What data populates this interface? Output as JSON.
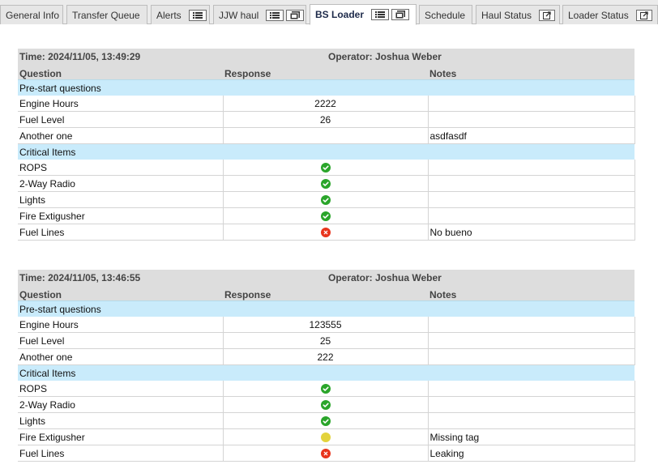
{
  "tabs": [
    {
      "label": "General Info",
      "active": false,
      "buttons": []
    },
    {
      "label": "Transfer Queue",
      "active": false,
      "buttons": []
    },
    {
      "label": "Alerts",
      "active": false,
      "buttons": [
        "list-icon"
      ]
    },
    {
      "label": "JJW haul",
      "active": false,
      "buttons": [
        "list-icon",
        "images-icon"
      ]
    },
    {
      "label": "BS Loader",
      "active": true,
      "buttons": [
        "list-icon",
        "images-icon"
      ]
    },
    {
      "label": "Schedule",
      "active": false,
      "buttons": []
    },
    {
      "label": "Haul Status",
      "active": false,
      "buttons": [
        "external-link-icon"
      ]
    },
    {
      "label": "Loader Status",
      "active": false,
      "buttons": [
        "external-link-icon"
      ]
    }
  ],
  "columns": {
    "question": "Question",
    "response": "Response",
    "notes": "Notes"
  },
  "colors": {
    "ok": "#2aa52a",
    "warn": "#e3d33c",
    "fail": "#e8341c",
    "section": "#c9ebfb",
    "header": "#dddddd"
  },
  "reports": [
    {
      "time": "Time: 2024/11/05, 13:49:29",
      "operator": "Operator: Joshua Weber",
      "sections": [
        {
          "title": "Pre-start questions",
          "rows": [
            {
              "question": "Engine Hours",
              "response": "2222",
              "notes": ""
            },
            {
              "question": "Fuel Level",
              "response": "26",
              "notes": ""
            },
            {
              "question": "Another one",
              "response": "",
              "notes": "asdfasdf"
            }
          ]
        },
        {
          "title": "Critical Items",
          "rows": [
            {
              "question": "ROPS",
              "status": "ok",
              "notes": ""
            },
            {
              "question": "2-Way Radio",
              "status": "ok",
              "notes": ""
            },
            {
              "question": "Lights",
              "status": "ok",
              "notes": ""
            },
            {
              "question": "Fire Extigusher",
              "status": "ok",
              "notes": ""
            },
            {
              "question": "Fuel Lines",
              "status": "fail",
              "notes": "No bueno"
            }
          ]
        }
      ]
    },
    {
      "time": "Time: 2024/11/05, 13:46:55",
      "operator": "Operator: Joshua Weber",
      "sections": [
        {
          "title": "Pre-start questions",
          "rows": [
            {
              "question": "Engine Hours",
              "response": "123555",
              "notes": ""
            },
            {
              "question": "Fuel Level",
              "response": "25",
              "notes": ""
            },
            {
              "question": "Another one",
              "response": "222",
              "notes": ""
            }
          ]
        },
        {
          "title": "Critical Items",
          "rows": [
            {
              "question": "ROPS",
              "status": "ok",
              "notes": ""
            },
            {
              "question": "2-Way Radio",
              "status": "ok",
              "notes": ""
            },
            {
              "question": "Lights",
              "status": "ok",
              "notes": ""
            },
            {
              "question": "Fire Extigusher",
              "status": "warn",
              "notes": "Missing tag"
            },
            {
              "question": "Fuel Lines",
              "status": "fail",
              "notes": "Leaking"
            }
          ]
        }
      ]
    }
  ]
}
